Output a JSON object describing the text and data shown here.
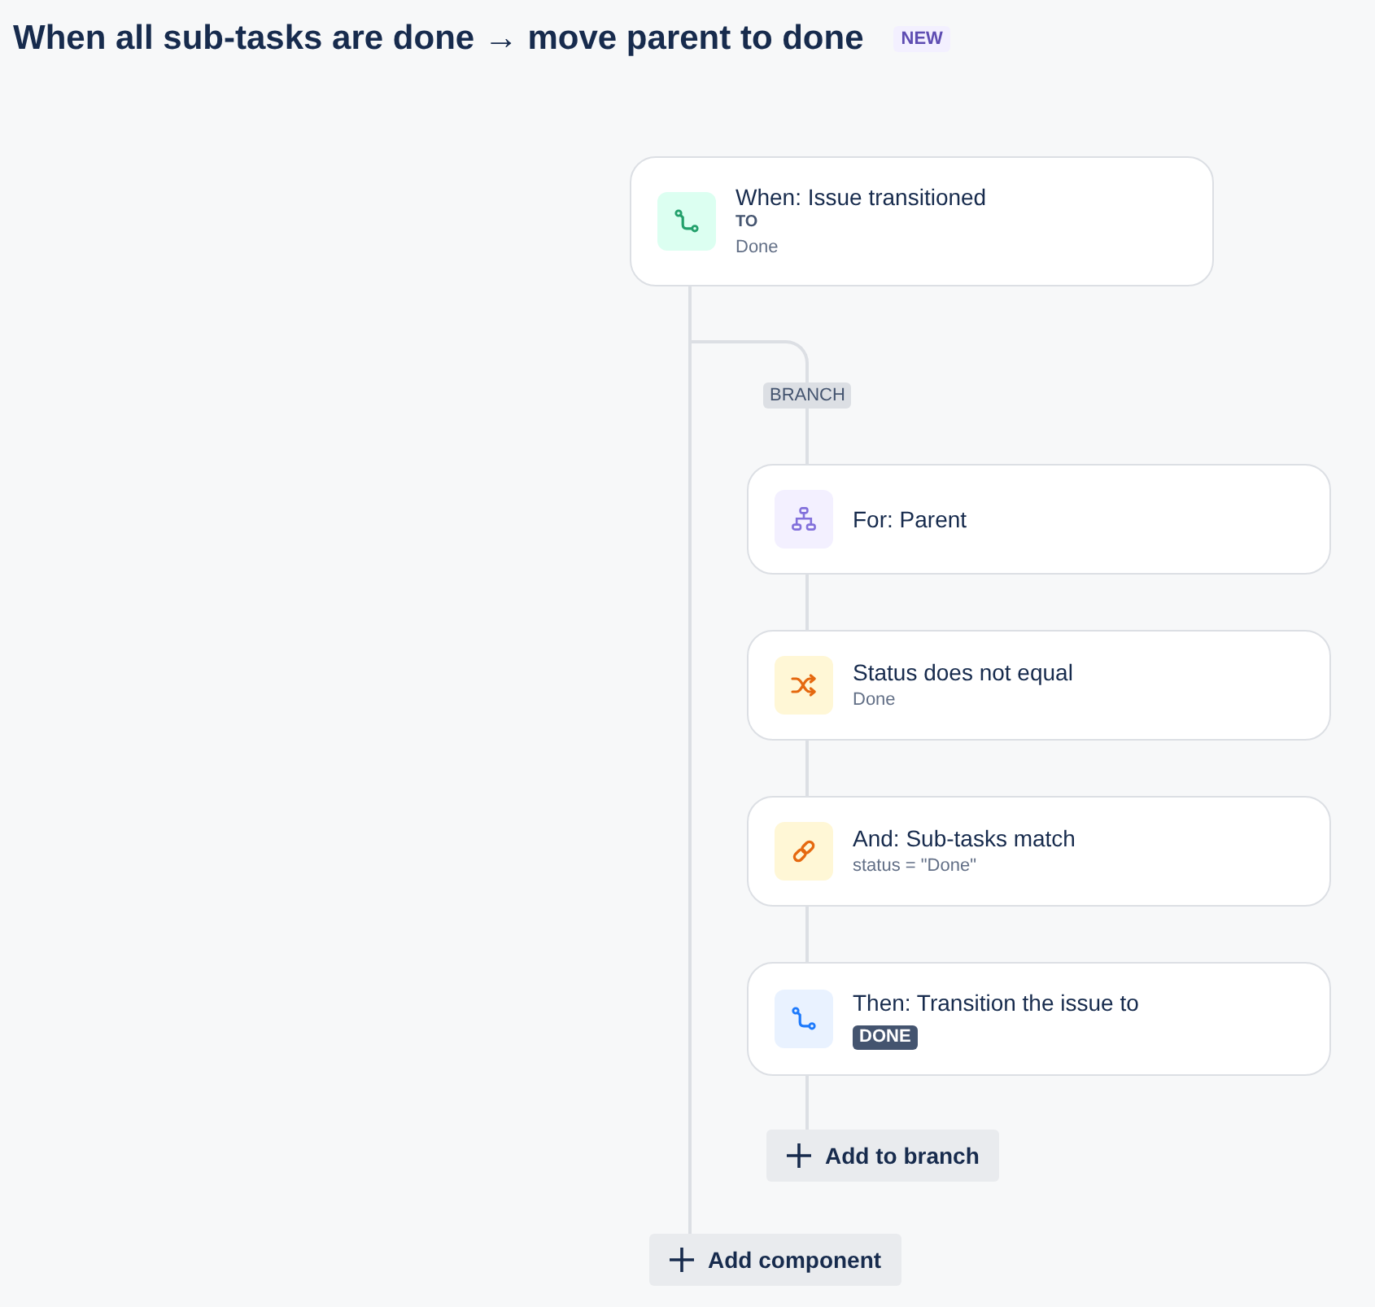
{
  "header": {
    "title": "When all sub-tasks are done → move parent to done",
    "badge": "NEW"
  },
  "trigger": {
    "kind": "trigger",
    "title": "When: Issue transitioned",
    "label": "TO",
    "detail": "Done"
  },
  "branch": {
    "label": "BRANCH",
    "components": [
      {
        "kind": "branch_rule",
        "title": "For: Parent"
      },
      {
        "kind": "field_condition",
        "title": "Status does not equal",
        "detail": "Done"
      },
      {
        "kind": "related_condition",
        "title": "And: Sub-tasks match",
        "detail": "status = \"Done\""
      },
      {
        "kind": "action",
        "title": "Then: Transition the issue to",
        "status": "DONE"
      }
    ],
    "add_button": "Add to branch"
  },
  "add_button": "Add component"
}
